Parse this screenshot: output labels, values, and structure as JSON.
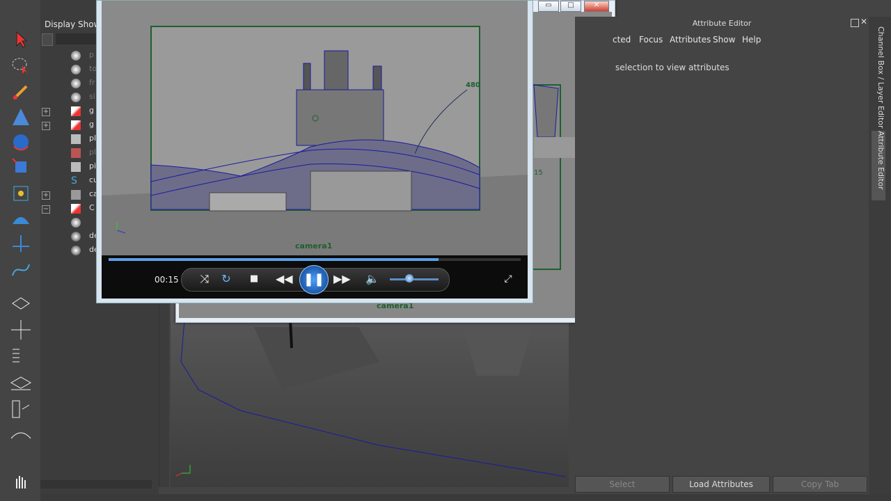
{
  "outliner": {
    "menu": [
      "Display",
      "Show"
    ],
    "rows": [
      {
        "label": "p",
        "icon": "camera-icon",
        "dim": true
      },
      {
        "label": "to",
        "icon": "camera-icon",
        "dim": true
      },
      {
        "label": "fr",
        "icon": "camera-icon",
        "dim": true
      },
      {
        "label": "si",
        "icon": "camera-icon",
        "dim": true
      },
      {
        "label": "g",
        "icon": "curve-surface-icon",
        "dim": false
      },
      {
        "label": "g",
        "icon": "curve-surface-icon",
        "dim": false
      },
      {
        "label": "pl",
        "icon": "mesh-icon",
        "dim": false
      },
      {
        "label": "pl",
        "icon": "mesh-icon",
        "dim": true
      },
      {
        "label": "pi",
        "icon": "mesh-icon",
        "dim": false
      },
      {
        "label": "cu",
        "icon": "curve-icon",
        "dim": false
      },
      {
        "label": "ca",
        "icon": "group-icon",
        "dim": false
      },
      {
        "label": "C",
        "icon": "curve-surface-icon",
        "dim": false
      },
      {
        "label": "",
        "icon": "camera-icon",
        "dim": false
      },
      {
        "label": "de",
        "icon": "sphere-icon",
        "dim": false
      },
      {
        "label": "de",
        "icon": "sphere-icon",
        "dim": false
      }
    ]
  },
  "attribute_editor": {
    "title": "Attribute Editor",
    "menu": [
      "cted",
      "Focus",
      "Attributes",
      "Show",
      "Help"
    ],
    "message": "selection to view attributes",
    "buttons": {
      "select": "Select",
      "load": "Load Attributes",
      "copy": "Copy Tab"
    }
  },
  "side_tabs": [
    "Channel Box / Layer Editor",
    "Attribute Editor"
  ],
  "viewport": {
    "camera_label": "camera1",
    "frame_number": "15"
  },
  "player": {
    "time": "00:15",
    "progress_fraction": 0.8,
    "volume_fraction": 0.4,
    "video_camera_label": "camera1",
    "video_frame_number": "480"
  },
  "colors": {
    "accent": "#5aa0e6",
    "wire": "#1a1aa0",
    "frame": "#1f5f2f"
  }
}
